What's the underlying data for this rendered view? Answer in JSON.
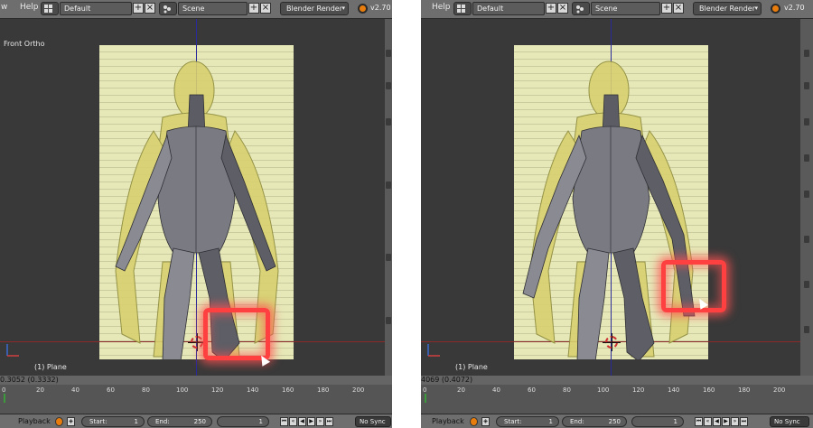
{
  "panels": [
    {
      "menu_cut": "w",
      "menu_help": "Help",
      "layout_name": "Default",
      "scene_name": "Scene",
      "render_engine": "Blender Render",
      "version": "v2.70",
      "view_label": "Front Ortho",
      "object_label": "(1) Plane",
      "timeline_value": "0.3052 (0.3332)",
      "start_label": "Start:",
      "start_value": "1",
      "end_label": "End:",
      "end_value": "250",
      "current_frame": "1",
      "sync": "No Sync",
      "playback": "Playback"
    },
    {
      "menu_cut": "",
      "menu_help": "Help",
      "layout_name": "Default",
      "scene_name": "Scene",
      "render_engine": "Blender Render",
      "version": "v2.70",
      "view_label": "",
      "object_label": "(1) Plane",
      "timeline_value": "4069 (0.4072)",
      "start_label": "Start:",
      "start_value": "1",
      "end_label": "End:",
      "end_value": "250",
      "current_frame": "1",
      "sync": "No Sync",
      "playback": "Playback"
    }
  ],
  "ruler_ticks": [
    "0",
    "20",
    "40",
    "60",
    "80",
    "100",
    "120",
    "140",
    "160",
    "180",
    "200"
  ],
  "colors": {
    "highlight": "#ff4040",
    "reference_image": "#e6e8b8",
    "mesh": "#6a6a72",
    "creature": "#d8d070"
  },
  "icons": {
    "layout": "screen-layout-icon",
    "scene": "scene-icon",
    "add": "plus-icon",
    "close": "close-icon",
    "render": "blender-logo-icon",
    "cursor": "3d-cursor-icon"
  }
}
